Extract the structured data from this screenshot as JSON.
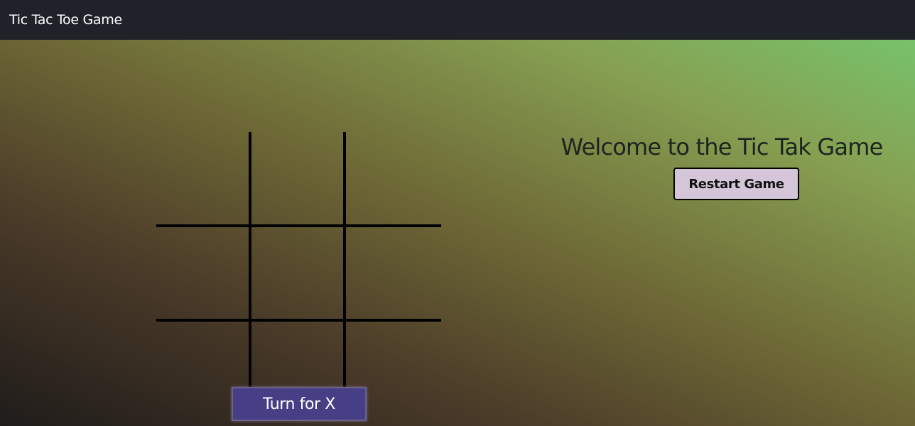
{
  "navbar": {
    "title": "Tic Tac Toe Game"
  },
  "board": {
    "cells": [
      "",
      "",
      "",
      "",
      "",
      "",
      "",
      "",
      ""
    ]
  },
  "status": {
    "turn_text": "Turn for X"
  },
  "panel": {
    "welcome_text": "Welcome to the Tic Tak Game",
    "restart_label": "Restart Game"
  },
  "colors": {
    "navbar_bg": "#1f2229",
    "turn_box_bg": "#463f85",
    "restart_bg": "#d4c6d8",
    "grid_line": "#000000"
  }
}
